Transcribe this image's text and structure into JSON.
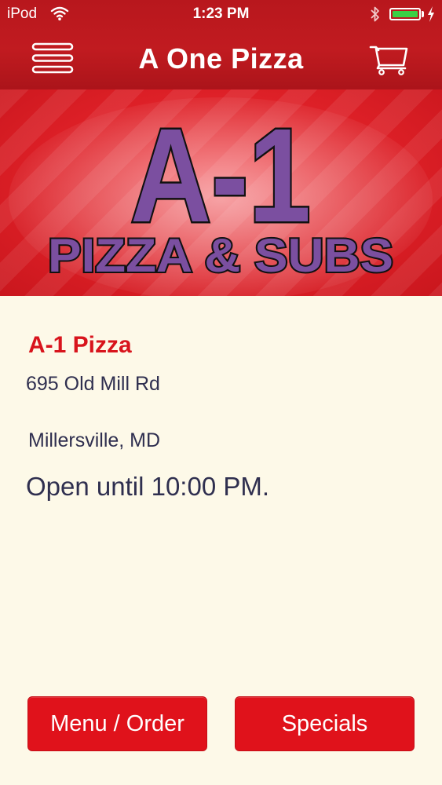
{
  "status_bar": {
    "carrier": "iPod",
    "time": "1:23 PM",
    "battery_percent": 100
  },
  "nav": {
    "title": "A One Pizza",
    "left_icon": "hamburger-menu-icon",
    "right_icon": "shopping-cart-icon"
  },
  "banner": {
    "logo_top": "A-1",
    "logo_bottom": "PIZZA & SUBS"
  },
  "store": {
    "name": "A-1 Pizza",
    "address": "695 Old Mill Rd",
    "city": "Millersville, MD",
    "hours": "Open until 10:00 PM."
  },
  "buttons": {
    "menu_order": "Menu / Order",
    "specials": "Specials"
  },
  "colors": {
    "brand_red": "#e0121b",
    "store_name_red": "#d8141c",
    "logo_purple": "#7b4fa0",
    "background_cream": "#fdf9e8",
    "battery_green": "#3ad144"
  }
}
